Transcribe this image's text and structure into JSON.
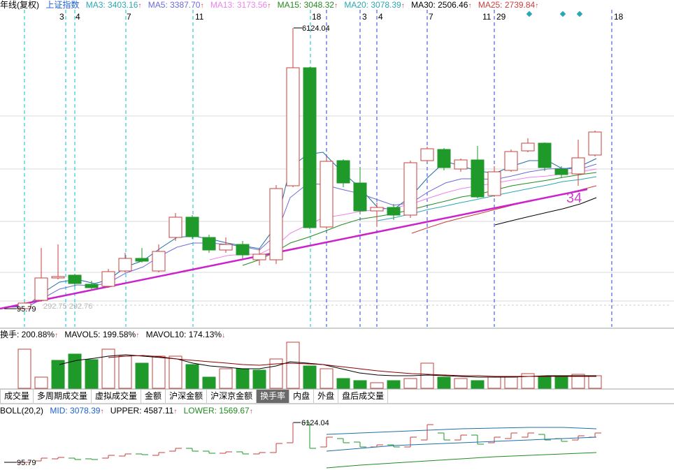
{
  "main_header": {
    "period_label": "年线(复权)",
    "index_name": "上证指数",
    "ma": [
      {
        "label": "MA3: 3403.16",
        "color": "#2aa7b4"
      },
      {
        "label": "MA5: 3387.70",
        "color": "#6a6ad8"
      },
      {
        "label": "MA13: 3173.56",
        "color": "#ee82ee"
      },
      {
        "label": "MA15: 3048.32",
        "color": "#228b22"
      },
      {
        "label": "MA20: 3078.39",
        "color": "#2aa7b4"
      },
      {
        "label": "MA30: 2506.46",
        "color": "#000000"
      },
      {
        "label": "MA25: 2739.84",
        "color": "#c8403c"
      }
    ]
  },
  "markers": {
    "cyan": [
      "3",
      "4",
      "7",
      "11",
      "18"
    ],
    "blue": [
      "3",
      "4",
      "7",
      "11",
      "29",
      "18"
    ]
  },
  "price_labels": {
    "high": "6124.04",
    "low": "95.79",
    "dashed_value": "292.75 292.76",
    "trend_label": "34"
  },
  "volume_header": {
    "turnover": "换手: 200.88%",
    "mavol5": "MAVOL5: 199.58%",
    "mavol10": "MAVOL10: 174.13%"
  },
  "tabs": [
    {
      "label": "成交量",
      "active": false
    },
    {
      "label": "多周期成交量",
      "active": false
    },
    {
      "label": "虚拟成交量",
      "active": false
    },
    {
      "label": "金额",
      "active": false
    },
    {
      "label": "沪深金额",
      "active": false
    },
    {
      "label": "沪深京金额",
      "active": false
    },
    {
      "label": "换手率",
      "active": true
    },
    {
      "label": "内盘",
      "active": false
    },
    {
      "label": "外盘",
      "active": false
    },
    {
      "label": "盘后成交量",
      "active": false
    }
  ],
  "boll_header": {
    "title": "BOLL(20,2)",
    "mid": "MID: 3078.39",
    "upper": "UPPER: 4587.11",
    "lower": "LOWER: 1569.67"
  },
  "boll_labels": {
    "high": "6124.04",
    "low": "95.79"
  },
  "colors": {
    "up": "#c8403c",
    "down": "#1f9a2a",
    "trendline": "#cc22cc",
    "cyan_line": "#00c0d0",
    "blue_line": "#2244dd"
  }
}
